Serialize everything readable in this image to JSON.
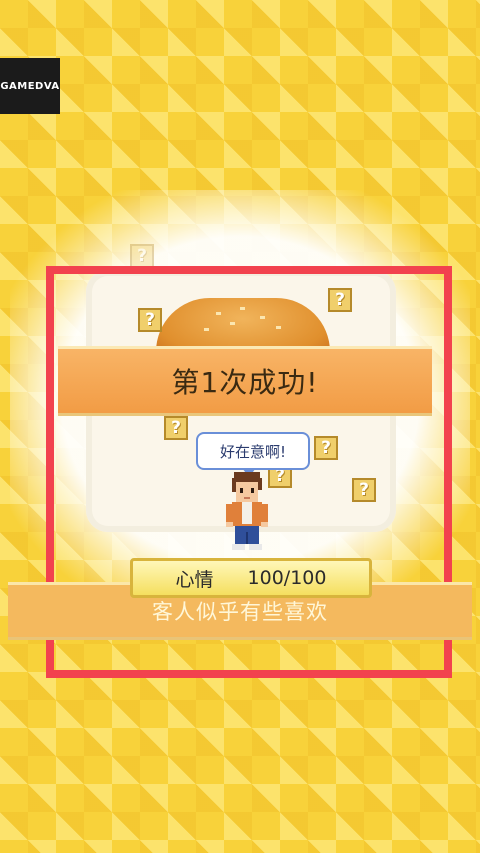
{
  "watermark": {
    "text": "GAMEDVA"
  },
  "result": {
    "banner": "第1次成功!"
  },
  "customer": {
    "speech": "好在意啊!",
    "mood_label": "心情",
    "mood_value": "100/100",
    "reaction": "客人似乎有些喜欢"
  },
  "colors": {
    "frame": "#f2424e",
    "banner": "#f29c45",
    "mood_bar": "#f5df5f",
    "background": "#f8d23a"
  },
  "icons": [
    "question-mark-icon",
    "hamburger-bun",
    "customer-sprite"
  ]
}
